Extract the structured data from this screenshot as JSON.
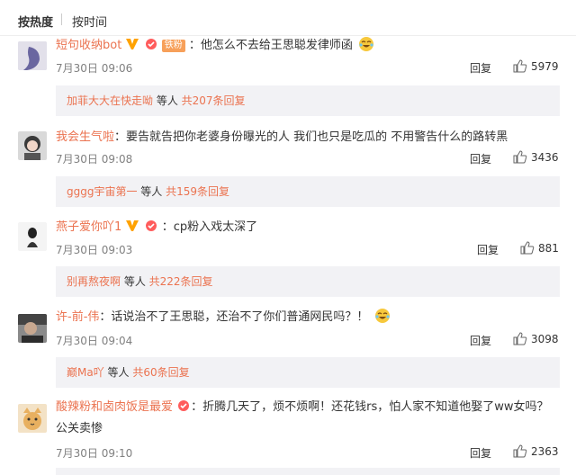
{
  "sort": {
    "hot": "按热度",
    "time": "按时间"
  },
  "comments": [
    {
      "user": "短句收纳bot",
      "text": "：他怎么不去给王思聪发律师函",
      "emoji": "laugh-cry-emoji",
      "time": "7月30日 09:06",
      "reply_label": "回复",
      "likes": "5979",
      "thread": {
        "user": "加菲大大在快走呦",
        "middle": " 等人 ",
        "count": "共207条回复"
      },
      "badges": [
        "v-badge",
        "fan-badge",
        "fan-label"
      ],
      "fan_label": "铁粉"
    },
    {
      "user": "我会生气啦",
      "text": "：要告就告把你老婆身份曝光的人 我们也只是吃瓜的 不用警告什么的路转黑",
      "time": "7月30日 09:08",
      "reply_label": "回复",
      "likes": "3436",
      "thread": {
        "user": "gggg宇宙第一",
        "middle": " 等人 ",
        "count": "共159条回复"
      }
    },
    {
      "user": "燕子爱你吖1",
      "text": "：cp粉入戏太深了",
      "time": "7月30日 09:03",
      "reply_label": "回复",
      "likes": "881",
      "thread": {
        "user": "别再熬夜啊",
        "middle": " 等人 ",
        "count": "共222条回复"
      },
      "badges": [
        "v-badge",
        "fan-badge"
      ]
    },
    {
      "user": "许-前-伟",
      "text": "：话说治不了王思聪，还治不了你们普通网民吗？！",
      "emoji": "laugh-cry-emoji",
      "time": "7月30日 09:04",
      "reply_label": "回复",
      "likes": "3098",
      "thread": {
        "user": "巅Ma吖",
        "middle": " 等人 ",
        "count": "共60条回复"
      }
    },
    {
      "user": "酸辣粉和卤肉饭是最爱",
      "text": "：折腾几天了，烦不烦啊！还花钱rs，怕人家不知道他娶了ww女吗？公关卖惨",
      "time": "7月30日 09:10",
      "reply_label": "回复",
      "likes": "2363",
      "badges": [
        "fan-badge"
      ]
    }
  ],
  "colors": {
    "link": "#eb7350",
    "time": "#808080",
    "reply_bg": "#f2f2f5",
    "vip": "#ffa200"
  }
}
